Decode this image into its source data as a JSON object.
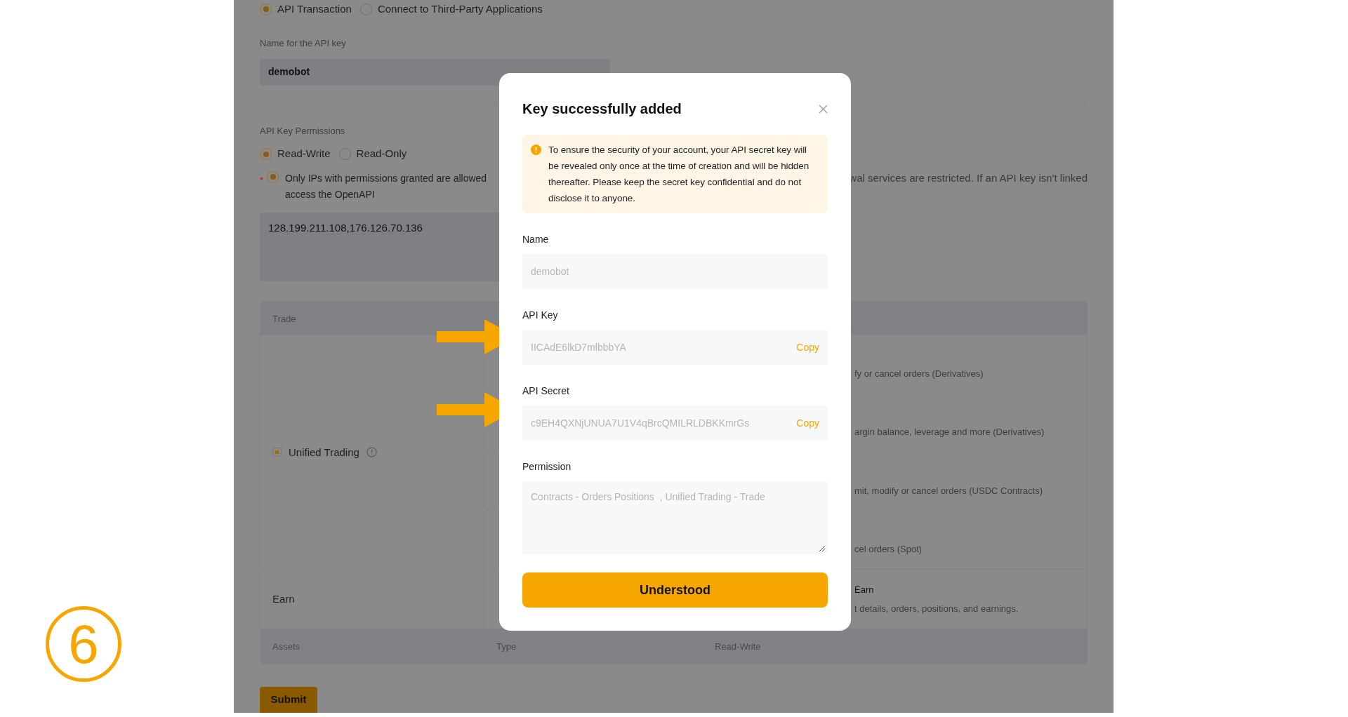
{
  "page": {
    "key_type_options": [
      {
        "label": "API Transaction",
        "selected": true
      },
      {
        "label": "Connect to Third-Party Applications",
        "selected": false
      }
    ],
    "name_field": {
      "label": "Name for the API key",
      "value": "demobot"
    },
    "permissions": {
      "label": "API Key Permissions",
      "options": [
        {
          "label": "Read-Write",
          "selected": true
        },
        {
          "label": "Read-Only",
          "selected": false
        }
      ]
    },
    "ip_option": {
      "selected": true,
      "required": true,
      "lines": [
        "Only IPs with permissions granted are allowed",
        "access the OpenAPI"
      ],
      "note_fragment": "wal services are restricted. If an API key isn't linked"
    },
    "ip_field": {
      "value": "128.199.211.108,176.126.70.136"
    },
    "trade_table": {
      "columns": [
        "Trade"
      ],
      "group": {
        "label": "Unified Trading",
        "checked": true,
        "column_3": [
          "fy or cancel orders (Derivatives)",
          "argin balance, leverage and more (Derivatives)",
          "mit, modify or cancel orders (USDC Contracts)",
          "cel orders (Spot)"
        ]
      },
      "earn_row": {
        "label": "Earn",
        "column_3_title": "Earn",
        "column_3_text": "t details, orders, positions, and earnings."
      }
    },
    "assets_table": {
      "columns": [
        "Assets",
        "Type",
        "Read-Write"
      ]
    },
    "submit": "Submit"
  },
  "dialog": {
    "title": "Key successfully added",
    "notice": "To ensure the security of your account, your API secret key will be revealed only once at the time of creation and will be hidden thereafter. Please keep the secret key confidential and do not disclose it to anyone.",
    "fields": [
      {
        "kind": "input",
        "label": "Name",
        "value": "demobot"
      },
      {
        "kind": "copy",
        "label": "API Key",
        "value": "IICAdE6lkD7mlbbbYA",
        "action": "Copy"
      },
      {
        "kind": "copy",
        "label": "API Secret",
        "value": "c9EH4QXNjUNUA7U1V4qBrcQMILRLDBKKmrGs",
        "action": "Copy"
      },
      {
        "kind": "textarea",
        "label": "Permission",
        "value": "Contracts - Orders Positions  , Unified Trading - Trade"
      }
    ],
    "button": "Understood"
  },
  "step_badge": "6"
}
